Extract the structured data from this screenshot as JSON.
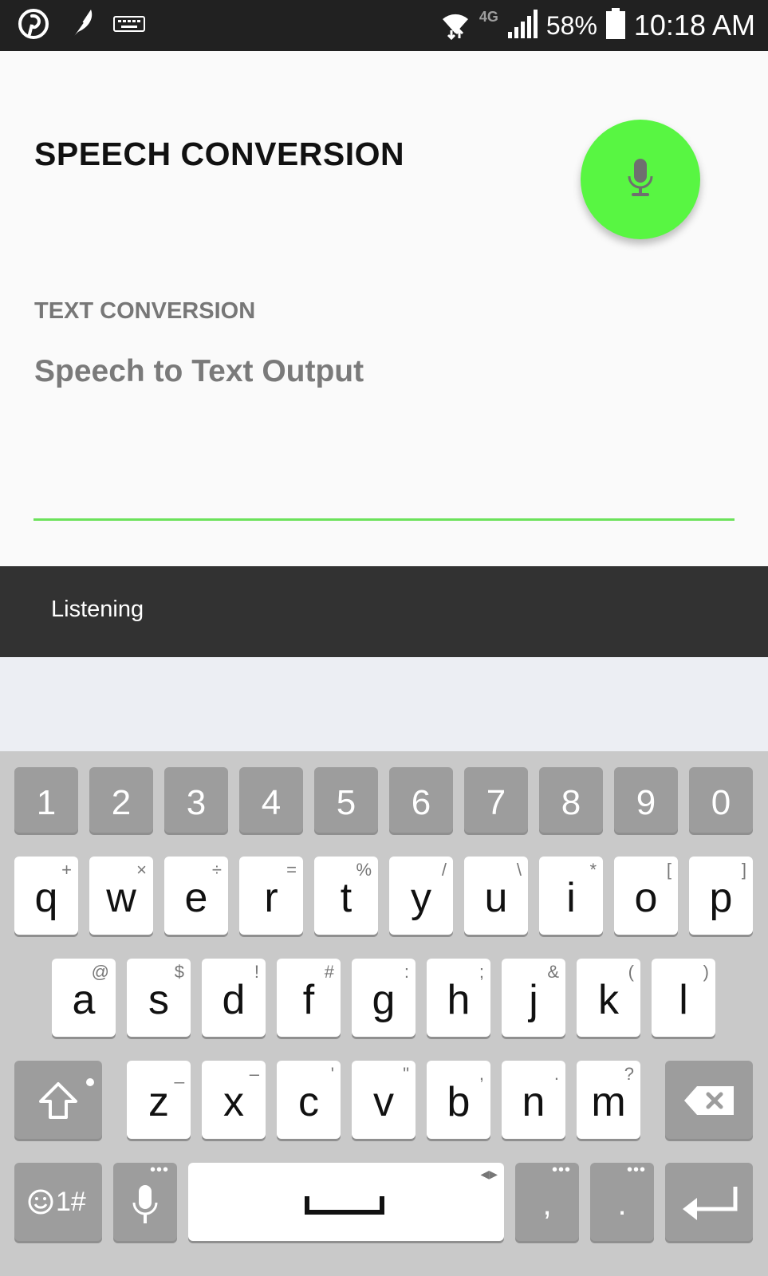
{
  "status_bar": {
    "network_label": "4G",
    "battery": "58%",
    "time": "10:18 AM",
    "left_icons": [
      "pinterest-icon",
      "feather-icon",
      "keyboard-icon"
    ],
    "right_icons": [
      "wifi-icon",
      "signal-icon",
      "battery-icon"
    ]
  },
  "app": {
    "title": "SPEECH CONVERSION",
    "section_label": "TEXT CONVERSION",
    "output_placeholder": "Speech to Text Output",
    "accent": "#58f642"
  },
  "snackbar": {
    "message": "Listening"
  },
  "keyboard": {
    "number_row": [
      "1",
      "2",
      "3",
      "4",
      "5",
      "6",
      "7",
      "8",
      "9",
      "0"
    ],
    "row1": [
      {
        "key": "q",
        "sym": "+"
      },
      {
        "key": "w",
        "sym": "×"
      },
      {
        "key": "e",
        "sym": "÷"
      },
      {
        "key": "r",
        "sym": "="
      },
      {
        "key": "t",
        "sym": "%"
      },
      {
        "key": "y",
        "sym": "/"
      },
      {
        "key": "u",
        "sym": "\\"
      },
      {
        "key": "i",
        "sym": "*"
      },
      {
        "key": "o",
        "sym": "["
      },
      {
        "key": "p",
        "sym": "]"
      }
    ],
    "row2": [
      {
        "key": "a",
        "sym": "@"
      },
      {
        "key": "s",
        "sym": "$"
      },
      {
        "key": "d",
        "sym": "!"
      },
      {
        "key": "f",
        "sym": "#"
      },
      {
        "key": "g",
        "sym": ":"
      },
      {
        "key": "h",
        "sym": ";"
      },
      {
        "key": "j",
        "sym": "&"
      },
      {
        "key": "k",
        "sym": "("
      },
      {
        "key": "l",
        "sym": ")"
      }
    ],
    "row3": [
      {
        "key": "z",
        "sym": "_"
      },
      {
        "key": "x",
        "sym": "–"
      },
      {
        "key": "c",
        "sym": "'"
      },
      {
        "key": "v",
        "sym": "\""
      },
      {
        "key": "b",
        "sym": ","
      },
      {
        "key": "n",
        "sym": "."
      },
      {
        "key": "m",
        "sym": "?"
      }
    ],
    "symbols_key": "1#",
    "comma_key": ",",
    "period_key": "."
  }
}
